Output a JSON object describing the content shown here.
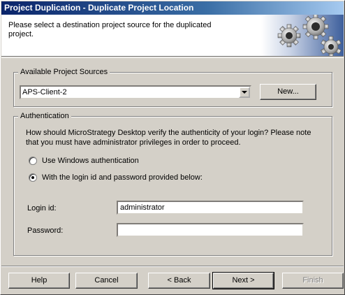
{
  "window": {
    "title": "Project Duplication - Duplicate Project Location"
  },
  "header": {
    "instruction": "Please select a destination project source for the duplicated project.",
    "graphic_icon": "gears-icon"
  },
  "project_sources": {
    "legend": "Available Project Sources",
    "selected": "APS-Client-2",
    "new_button": "New..."
  },
  "authentication": {
    "legend": "Authentication",
    "description": "How should MicroStrategy Desktop verify the authenticity of your login? Please note that you must have administrator privileges in order to proceed.",
    "options": [
      {
        "label": "Use Windows authentication",
        "selected": false
      },
      {
        "label": "With the login id and password provided below:",
        "selected": true
      }
    ],
    "login_label": "Login id:",
    "login_value": "administrator",
    "password_label": "Password:",
    "password_value": ""
  },
  "buttons": {
    "help": "Help",
    "cancel": "Cancel",
    "back": "< Back",
    "next": "Next >",
    "finish": "Finish"
  }
}
